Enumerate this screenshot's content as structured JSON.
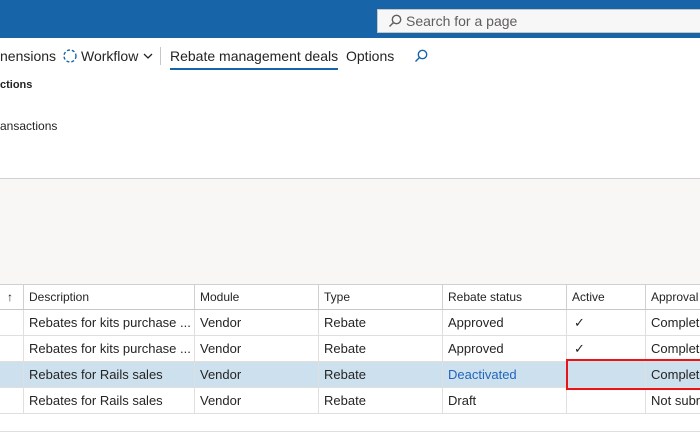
{
  "topbar": {
    "search_placeholder": "Search for a page",
    "search_icon": "search-icon"
  },
  "actionpane": {
    "dimensions_label": "nensions",
    "workflow_label": "Workflow",
    "rebate_deals_label": "Rebate management deals",
    "options_label": "Options"
  },
  "ribbon": {
    "group_title": "ctions",
    "group_item": "ansactions"
  },
  "grid": {
    "columns": [
      "Description",
      "Module",
      "Type",
      "Rebate status",
      "Active",
      "Approval"
    ],
    "rows": [
      {
        "description": "Rebates for kits purchase ...",
        "module": "Vendor",
        "type": "Rebate",
        "status": "Approved",
        "active": "✓",
        "approval": "Complet"
      },
      {
        "description": "Rebates for kits purchase ...",
        "module": "Vendor",
        "type": "Rebate",
        "status": "Approved",
        "active": "✓",
        "approval": "Complet"
      },
      {
        "description": "Rebates for Rails sales",
        "module": "Vendor",
        "type": "Rebate",
        "status": "Deactivated",
        "active": "",
        "approval": "Complet"
      },
      {
        "description": "Rebates for Rails sales",
        "module": "Vendor",
        "type": "Rebate",
        "status": "Draft",
        "active": "",
        "approval": "Not subr"
      }
    ],
    "sort_arrow": "↑"
  }
}
